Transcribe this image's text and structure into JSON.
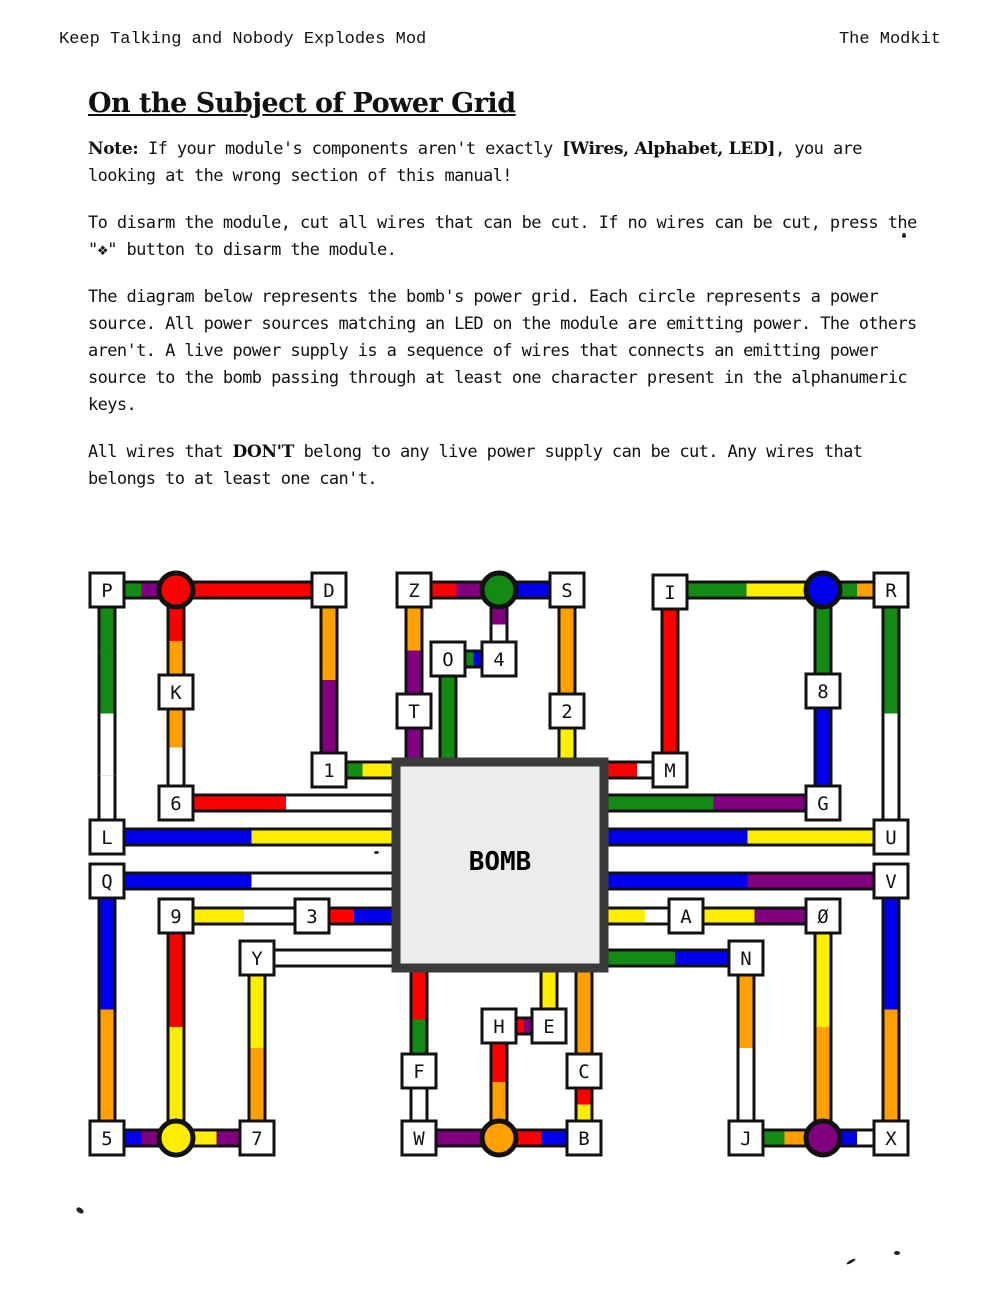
{
  "header": {
    "left": "Keep Talking and Nobody Explodes Mod",
    "right": "The Modkit"
  },
  "title": "On the Subject of Power Grid",
  "paragraphs": {
    "p1": {
      "note": "Note:",
      "t1": " If your module's components aren't exactly ",
      "components": "[Wires, Alphabet, LED]",
      "t2": ", you are looking at the wrong section of this manual!"
    },
    "p2": "To disarm the module, cut all wires that can be cut. If no wires can be cut, press the \"❖\" button to disarm the module.",
    "p3": "The diagram below represents the bomb's power grid. Each circle represents a power source. All power sources matching an LED on the module are emitting power. The others aren't. A live power supply is a sequence of wires that connects an emitting power source to the bomb passing through at least one character present in the alphanumeric keys.",
    "p4": {
      "t1": "All wires that ",
      "dont": "DON'T",
      "t2": " belong to any live power supply can be cut. Any wires that belongs to at least one can't."
    }
  },
  "diagram": {
    "bomb_label": "BOMB",
    "colors": {
      "red": "#ff0000",
      "green": "#138a13",
      "blue": "#0000ee",
      "yellow": "#ffee00",
      "orange": "#ffa000",
      "purple": "#800080",
      "white": "#ffffff"
    },
    "sources": [
      {
        "id": "red-source",
        "color": "red"
      },
      {
        "id": "green-source",
        "color": "green"
      },
      {
        "id": "blue-source",
        "color": "blue"
      },
      {
        "id": "yellow-source",
        "color": "yellow"
      },
      {
        "id": "orange-source",
        "color": "orange"
      },
      {
        "id": "purple-source",
        "color": "purple"
      }
    ],
    "nodes": [
      "P",
      "D",
      "Z",
      "S",
      "I",
      "R",
      "O",
      "4",
      "K",
      "T",
      "2",
      "8",
      "1",
      "M",
      "6",
      "G",
      "L",
      "U",
      "Q",
      "V",
      "9",
      "3",
      "A",
      "Ø",
      "Y",
      "N",
      "H",
      "E",
      "F",
      "C",
      "5",
      "7",
      "W",
      "B",
      "J",
      "X"
    ]
  }
}
